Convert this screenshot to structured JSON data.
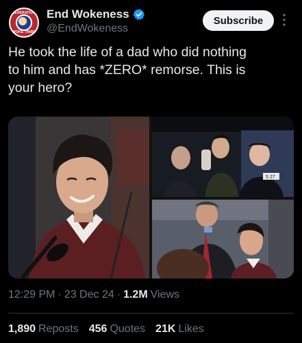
{
  "author": {
    "avatar_top_text": "FEDERATION",
    "avatar_bottom_text": "WOKE TRIBE",
    "display_name": "End Wokeness",
    "handle": "@EndWokeness",
    "verified": true
  },
  "actions": {
    "subscribe_label": "Subscribe",
    "more_icon": "more-vertical-icon"
  },
  "tweet": {
    "text": "He took the life of a dad who did nothing\nto him and has *ZERO* remorse. This is\nyour hero?"
  },
  "media": {
    "photos": [
      {
        "name": "photo-man-smiling-courtroom"
      },
      {
        "name": "photo-car-interior-three-men"
      },
      {
        "name": "photo-man-with-lawyer"
      }
    ],
    "visible_label": "5 27"
  },
  "meta": {
    "time": "12:29 PM",
    "sep1": "·",
    "date": "23 Dec 24",
    "sep2": "·",
    "views_count": "1.2M",
    "views_label": "Views"
  },
  "stats": {
    "reposts_count": "1,890",
    "reposts_label": "Reposts",
    "quotes_count": "456",
    "quotes_label": "Quotes",
    "likes_count": "21K",
    "likes_label": "Likes"
  },
  "colors": {
    "background": "#000000",
    "text": "#e7e9ea",
    "muted": "#71767b",
    "verified": "#1d9bf0",
    "button_bg": "#eff3f4"
  }
}
